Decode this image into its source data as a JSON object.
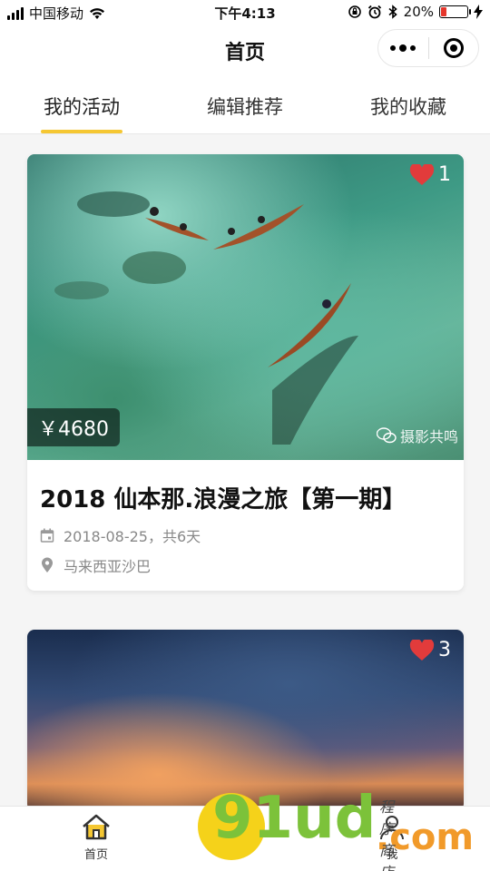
{
  "status": {
    "carrier": "中国移动",
    "time": "下午4:13",
    "battery": "20%",
    "battery_level": 0.2,
    "battery_color": "#e5362b"
  },
  "nav": {
    "title": "首页",
    "more_icon": "more-dots-icon",
    "close_icon": "target-circle-icon"
  },
  "tabs": [
    {
      "label": "我的活动",
      "active": true
    },
    {
      "label": "编辑推荐",
      "active": false
    },
    {
      "label": "我的收藏",
      "active": false
    }
  ],
  "accent_color": "#f5c732",
  "cards": [
    {
      "likes": "1",
      "price": "￥4680",
      "watermark": "摄影共鸣",
      "title": "2018 仙本那.浪漫之旅【第一期】",
      "date": "2018-08-25，共6天",
      "location": "马来西亚沙巴"
    },
    {
      "likes": "3"
    }
  ],
  "tabbar": {
    "home_label": "首页",
    "me_label": "我"
  },
  "brand": {
    "text": "91ud",
    "suffix": ".com",
    "tag": "程序商店"
  }
}
